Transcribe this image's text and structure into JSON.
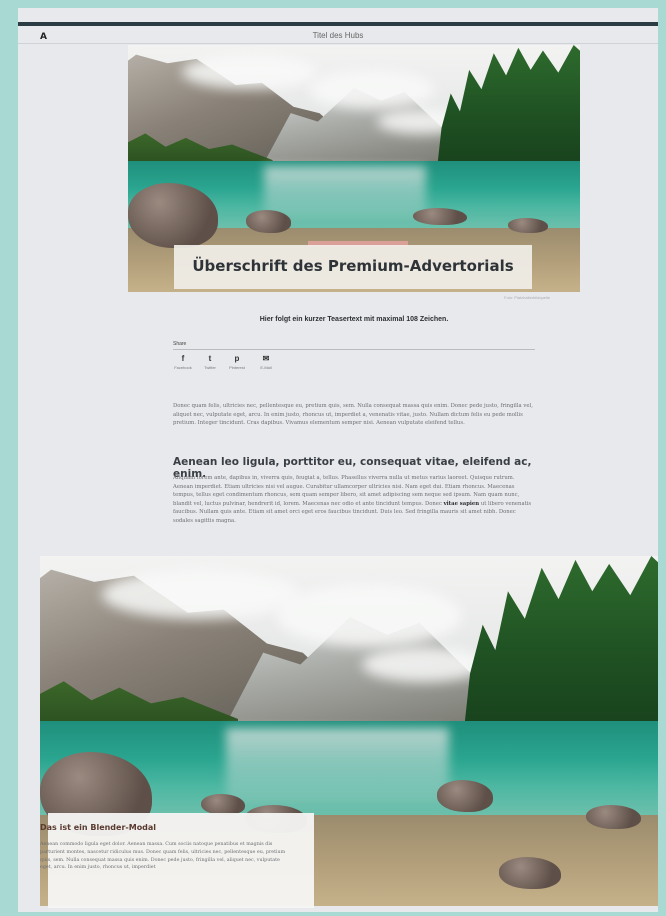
{
  "header": {
    "logo": "A",
    "page_title": "Titel des Hubs"
  },
  "hero": {
    "title": "Überschrift des Premium-Advertorials",
    "image_credit": "Foto: Platzhalterbildquelle"
  },
  "teaser": "Hier folgt ein kurzer Teasertext mit maximal 108 Zeichen.",
  "share": {
    "label": "Share",
    "buttons": [
      {
        "icon": "facebook-icon",
        "glyph": "f",
        "label": "Facebook"
      },
      {
        "icon": "twitter-icon",
        "glyph": "t",
        "label": "Twitter"
      },
      {
        "icon": "pinterest-icon",
        "glyph": "p",
        "label": "Pinterest"
      },
      {
        "icon": "email-icon",
        "glyph": "✉",
        "label": "E-Mail"
      }
    ]
  },
  "article": {
    "para1": "Donec quam felis, ultricies nec, pellentesque eu, pretium quis, sem. Nulla consequat massa quis enim. Donec pede justo, fringilla vel, aliquet nec, vulputate eget, arcu. In enim justo, rhoncus ut, imperdiet a, venenatis vitae, justo. Nullam dictum felis eu pede mollis pretium. Integer tincidunt. Cras dapibus. Vivamus elementum semper nisi. Aenean vulputate eleifend tellus.",
    "subheading": "Aenean leo ligula, porttitor eu, consequat vitae, eleifend ac, enim.",
    "para2_before": "Aliquam lorem ante, dapibus in, viverra quis, feugiat a, tellus. Phasellus viverra nulla ut metus varius laoreet. Quisque rutrum. Aenean imperdiet. Etiam ultricies nisi vel augue. Curabitur ullamcorper ultricies nisi. Nam eget dui. Etiam rhoncus. Maecenas tempus, tellus eget condimentum rhoncus, sem quam semper libero, sit amet adipiscing sem neque sed ipsum. Nam quam nunc, blandit vel, luctus pulvinar, hendrerit id, lorem. Maecenas nec odio et ante tincidunt tempus. Donec ",
    "para2_bold": "vitae sapien",
    "para2_after": " ut libero venenatis faucibus. Nullam quis ante. Etiam sit amet orci eget eros faucibus tincidunt. Duis leo. Sed fringilla mauris sit amet nibh. Donec sodales sagittis magna."
  },
  "modal": {
    "title": "Das ist ein Blender-Modal",
    "text": "Aenean commodo ligula eget dolor. Aenean massa. Cum sociis natoque penatibus et magnis dis parturient montes, nascetur ridiculus mus. Donec quam felis, ultricies nec, pellentesque eu, pretium quis, sem. Nulla consequat massa quis enim. Donec pede justo, fringilla vel, aliquet nec, vulputate eget, arcu. In enim justo, rhoncus ut, imperdiet"
  },
  "colors": {
    "page_background": "#a8dad3",
    "canvas": "#e8e9ec",
    "header_rule": "#2c3c44",
    "lake_teal": "#2aa58f",
    "forest_green": "#1e4f22",
    "modal_title": "#5a3a2e"
  }
}
